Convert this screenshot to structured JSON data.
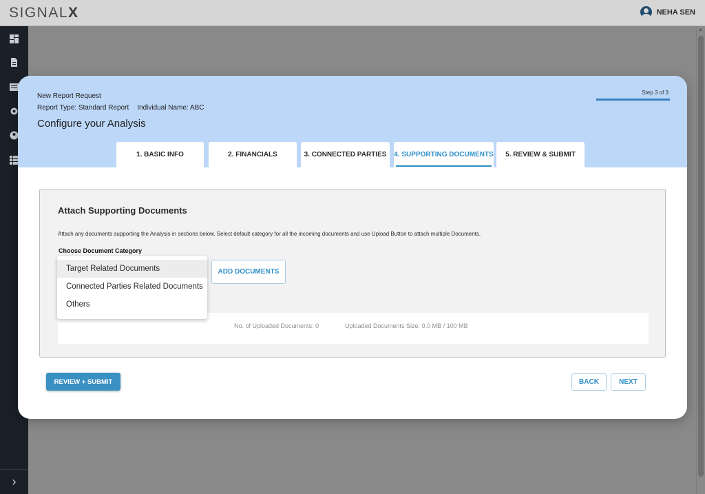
{
  "app": {
    "logo_text": "SIGNAL",
    "logo_bold": "X"
  },
  "user": {
    "name": "NEHA SEN",
    "icon": "account-circle-icon"
  },
  "sidebar": {
    "icons": [
      "dashboard-icon",
      "document-icon",
      "list-icon",
      "settings-icon",
      "account-icon",
      "table-icon"
    ],
    "expand_glyph": "›"
  },
  "modal": {
    "header": {
      "line1": "New Report Request",
      "report_type": "Report Type: Standard Report",
      "individual": "Individual Name: ABC",
      "title": "Configure your Analysis",
      "step_text": "Step 3 of 3"
    },
    "tabs": [
      {
        "label": "1. BASIC INFO",
        "active": false
      },
      {
        "label": "2. FINANCIALS",
        "active": false
      },
      {
        "label": "3. CONNECTED PARTIES",
        "active": false
      },
      {
        "label": "4. SUPPORTING DOCUMENTS",
        "active": true
      },
      {
        "label": "5. REVIEW & SUBMIT",
        "active": false
      }
    ],
    "section": {
      "title": "Attach Supporting Documents",
      "description": "Attach any documents supporting the Analysis in sections below. Select default category for all the incoming documents and use Upload Button to attach multiple Documents.",
      "category_label": "Choose Document Category",
      "add_button": "ADD DOCUMENTS",
      "uploaded_count": "No. of Uploaded Documents: 0",
      "uploaded_size": "Uploaded Documents Size: 0.0 MB / 100 MB"
    },
    "dropdown": {
      "options": [
        "Target Related Documents",
        "Connected Parties Related Documents",
        "Others"
      ],
      "highlighted_index": 0
    },
    "footer": {
      "review_submit": "REVIEW + SUBMIT",
      "back": "BACK",
      "next": "NEXT"
    }
  },
  "colors": {
    "accent": "#2f8fc8",
    "header_bg": "#bcd7f8",
    "primary_button": "#3a90c3",
    "rail": "#1b2028"
  }
}
